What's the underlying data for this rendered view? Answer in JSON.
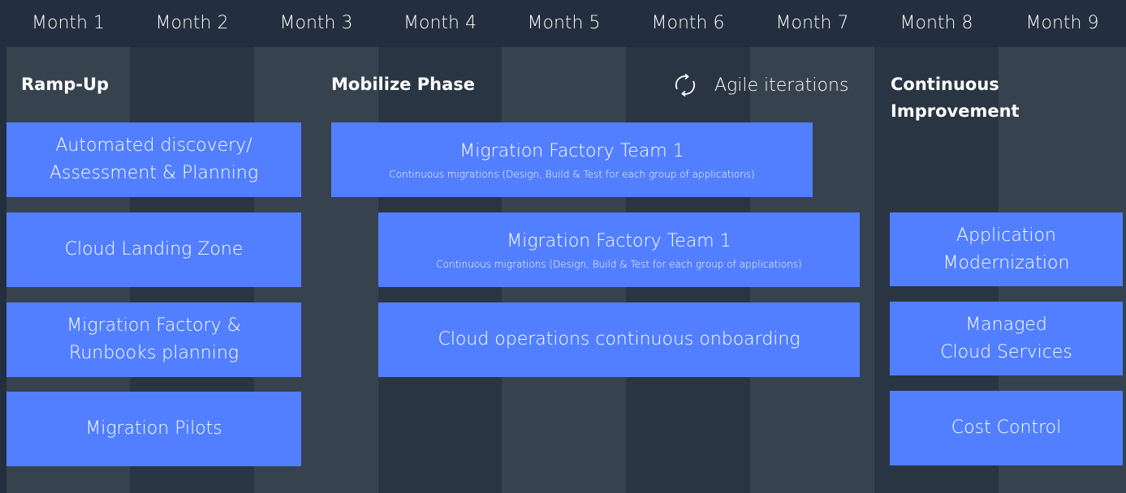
{
  "months": [
    "Month 1",
    "Month 2",
    "Month 3",
    "Month 4",
    "Month 5",
    "Month 6",
    "Month 7",
    "Month 8",
    "Month 9"
  ],
  "phases": {
    "ramp_up": "Ramp-Up",
    "mobilize": "Mobilize Phase",
    "agile": "Agile iterations",
    "continuous": "Continuous\nImprovement"
  },
  "ramp_up_boxes": [
    "Automated discovery/\nAssessment & Planning",
    "Cloud Landing Zone",
    "Migration Factory &\nRunbooks planning",
    "Migration Pilots"
  ],
  "mobilize_boxes": [
    {
      "title": "Migration Factory Team 1",
      "subtitle": "Continuous migrations (Design, Build & Test for each group of applications)"
    },
    {
      "title": "Migration Factory Team 1",
      "subtitle": "Continuous migrations (Design, Build & Test for each group of applications)"
    },
    {
      "title": "Cloud operations continuous onboarding"
    }
  ],
  "continuous_boxes": [
    "Application\nModernization",
    "Managed\nCloud Services",
    "Cost Control"
  ],
  "colors": {
    "background": "#232f3e",
    "column_light": "#37424f",
    "column_dark": "#2a3543",
    "box": "#527fff"
  },
  "icons": {
    "agile": "refresh-cycle-icon"
  }
}
